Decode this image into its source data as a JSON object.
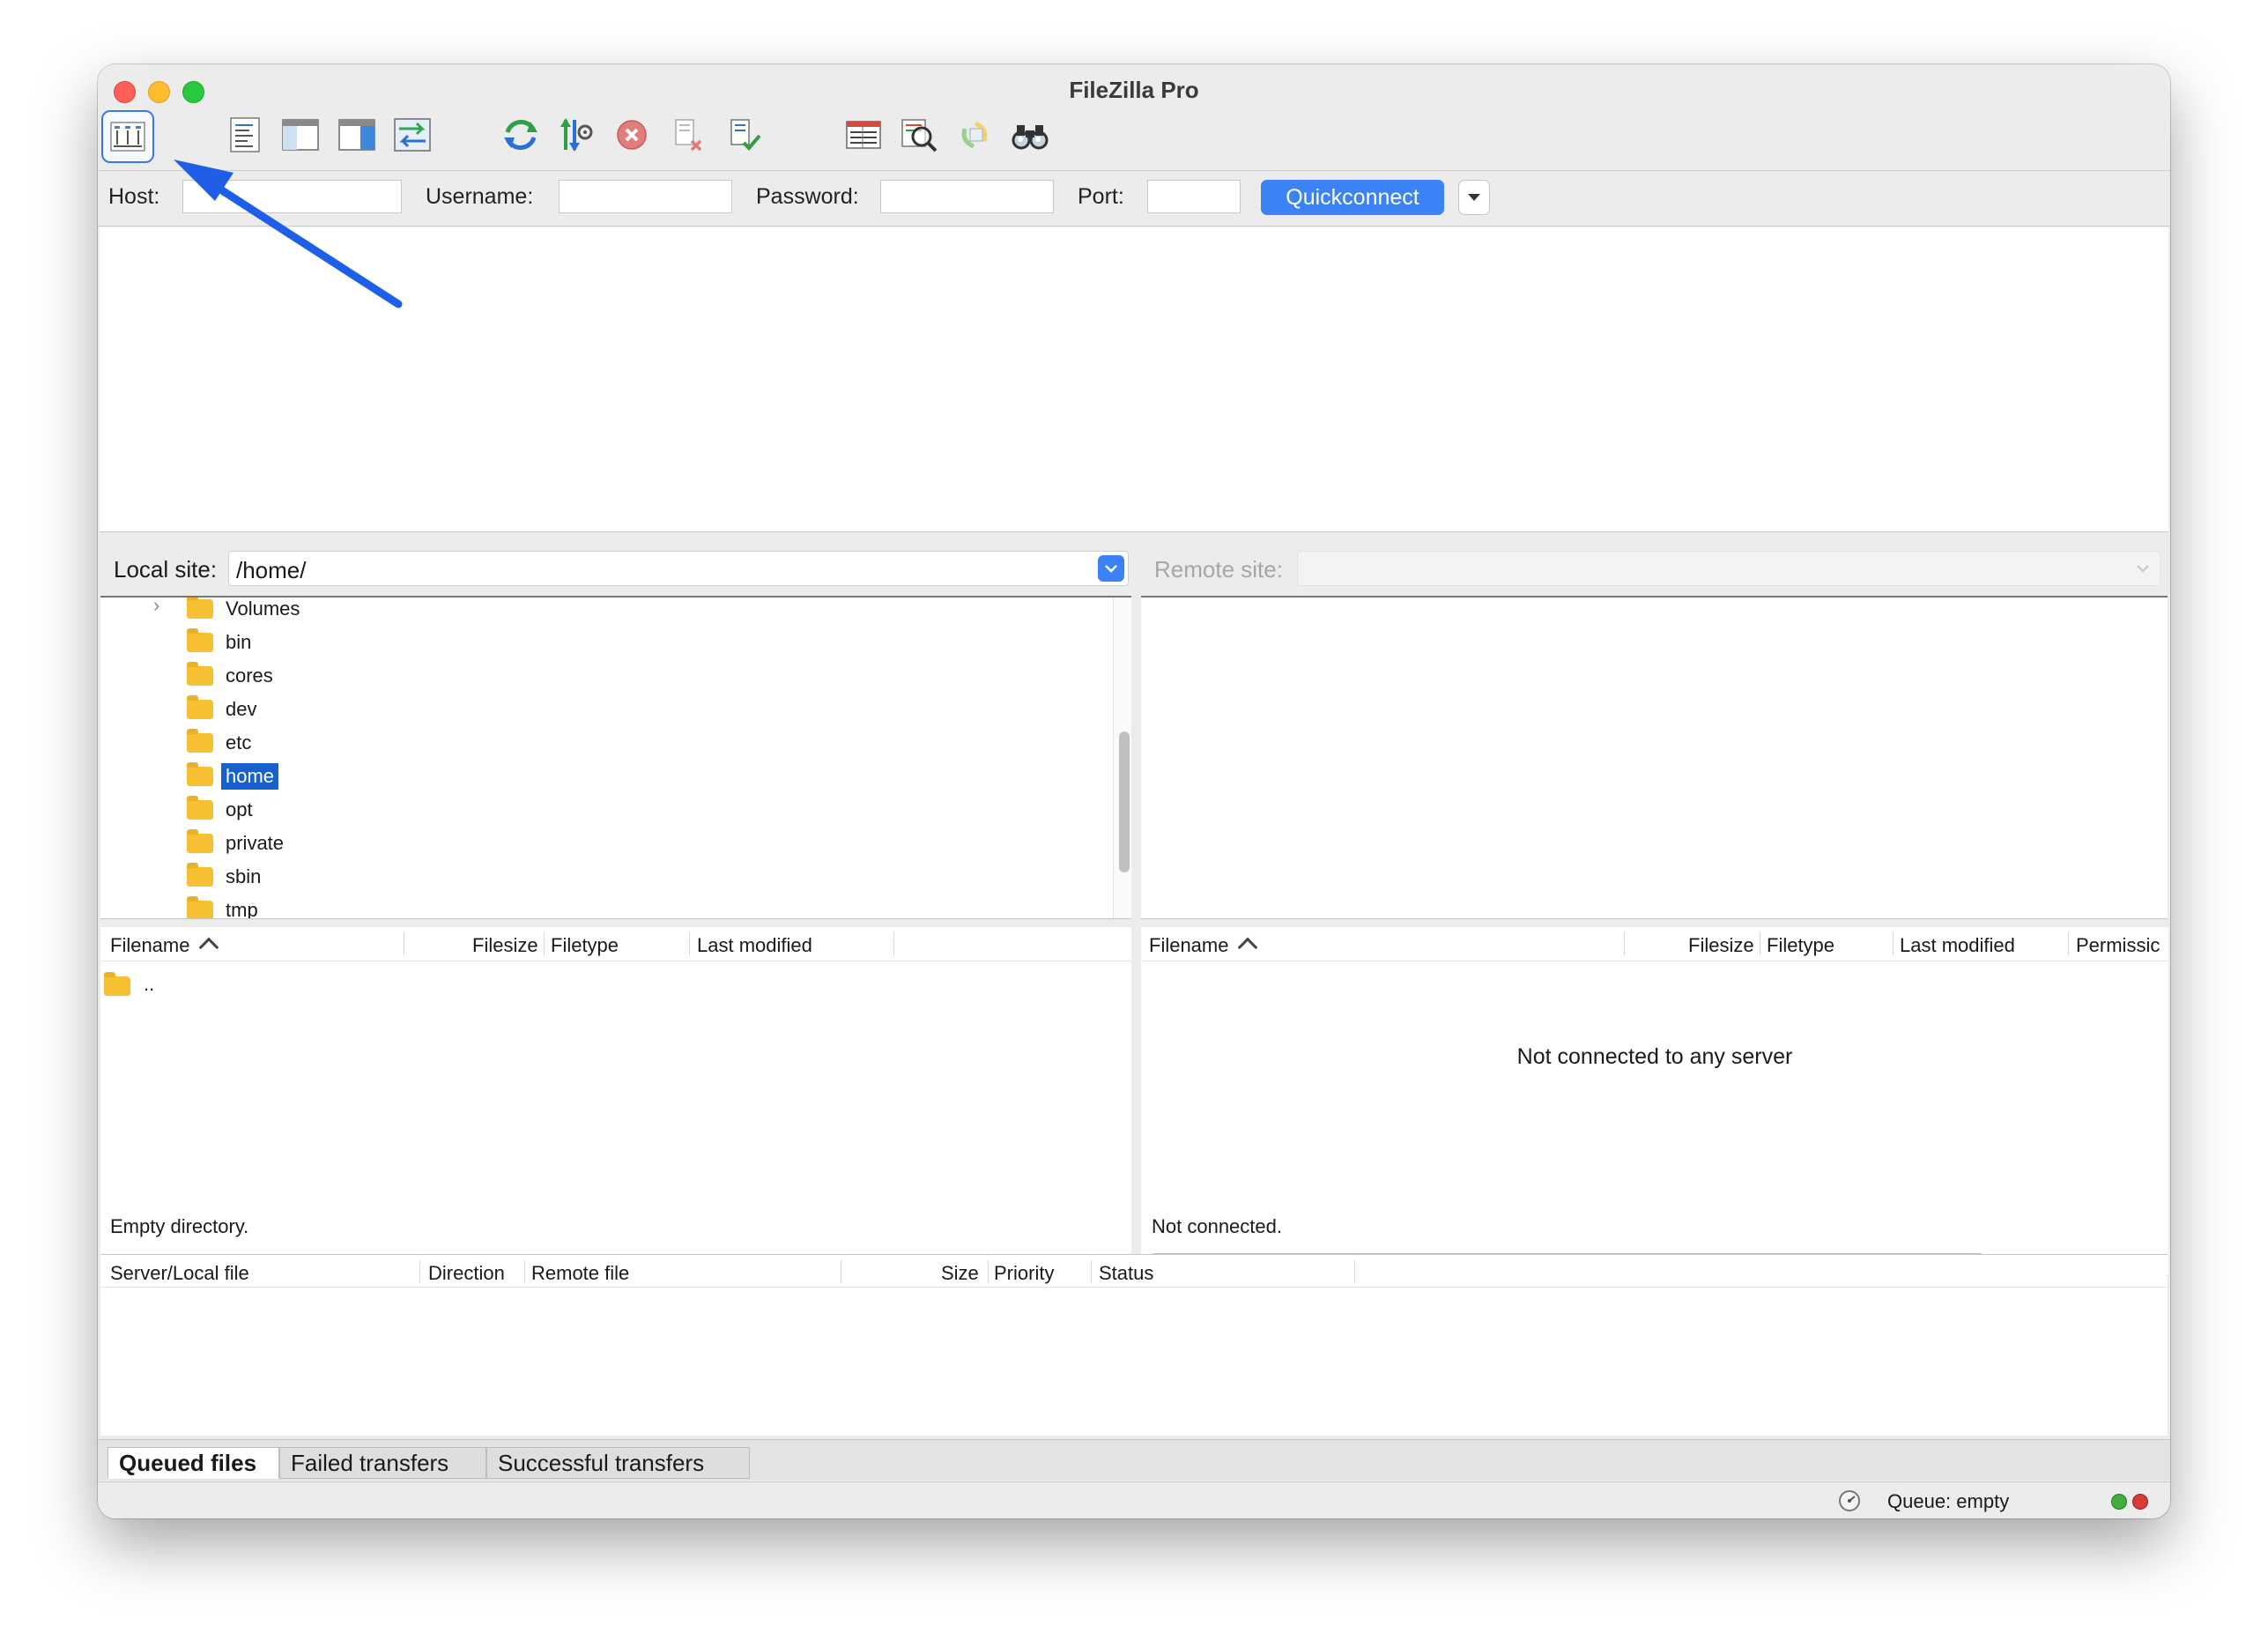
{
  "window": {
    "title": "FileZilla Pro"
  },
  "toolbar": {
    "buttons": [
      "site-manager-icon",
      "message-log-toggle-icon",
      "local-tree-toggle-icon",
      "remote-tree-toggle-icon",
      "transfer-queue-toggle-icon",
      "refresh-icon",
      "process-queue-icon",
      "cancel-operation-icon",
      "disconnect-icon",
      "reconnect-icon",
      "directory-listing-filters-icon",
      "toggle-directory-comparison-icon",
      "synchronized-browsing-icon",
      "search-remote-files-icon"
    ]
  },
  "quickconnect": {
    "host_label": "Host:",
    "username_label": "Username:",
    "password_label": "Password:",
    "port_label": "Port:",
    "host_value": "",
    "username_value": "",
    "password_value": "",
    "port_value": "",
    "button_label": "Quickconnect"
  },
  "local": {
    "site_label": "Local site:",
    "path": "/home/",
    "tree": [
      {
        "label": "Volumes",
        "expandable": true,
        "selected": false
      },
      {
        "label": "bin",
        "expandable": false,
        "selected": false
      },
      {
        "label": "cores",
        "expandable": false,
        "selected": false
      },
      {
        "label": "dev",
        "expandable": false,
        "selected": false
      },
      {
        "label": "etc",
        "expandable": false,
        "selected": false
      },
      {
        "label": "home",
        "expandable": false,
        "selected": true
      },
      {
        "label": "opt",
        "expandable": false,
        "selected": false
      },
      {
        "label": "private",
        "expandable": false,
        "selected": false
      },
      {
        "label": "sbin",
        "expandable": false,
        "selected": false
      },
      {
        "label": "tmp",
        "expandable": false,
        "selected": false
      }
    ],
    "columns": {
      "filename": "Filename",
      "filesize": "Filesize",
      "filetype": "Filetype",
      "last_modified": "Last modified"
    },
    "parent_entry": "..",
    "status": "Empty directory."
  },
  "remote": {
    "site_label": "Remote site:",
    "path": "",
    "columns": {
      "filename": "Filename",
      "filesize": "Filesize",
      "filetype": "Filetype",
      "last_modified": "Last modified",
      "permissions": "Permissic"
    },
    "message": "Not connected to any server",
    "status": "Not connected."
  },
  "queue": {
    "columns": {
      "server_local_file": "Server/Local file",
      "direction": "Direction",
      "remote_file": "Remote file",
      "size": "Size",
      "priority": "Priority",
      "status": "Status"
    },
    "tabs": [
      "Queued files",
      "Failed transfers",
      "Successful transfers"
    ],
    "active_tab": "Queued files"
  },
  "statusbar": {
    "queue_text": "Queue: empty"
  },
  "colors": {
    "accent": "#3b82f6",
    "selection": "#1761cf",
    "annotation_arrow": "#1f5fe8",
    "led_green": "#3fae3a",
    "led_red": "#d63a3a"
  }
}
